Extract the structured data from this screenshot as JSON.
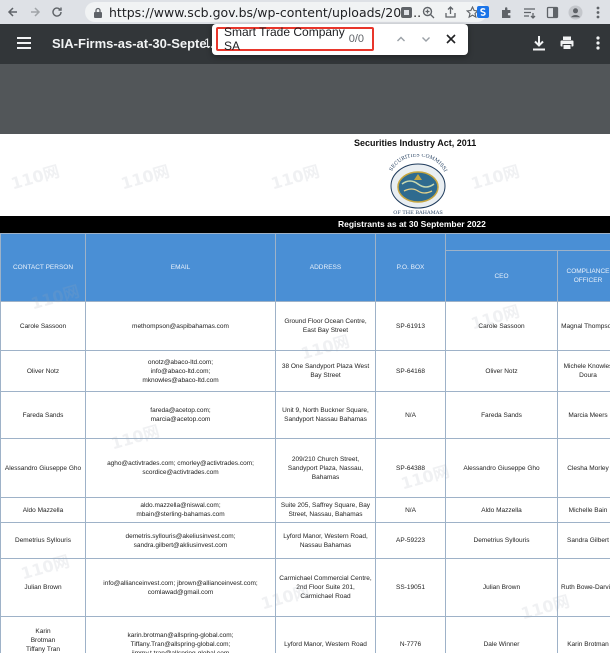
{
  "browser": {
    "url": "https://www.scb.gov.bs/wp-content/uploads/202..."
  },
  "pdf_toolbar": {
    "title": "SIA-Firms-as-at-30-Septe...",
    "page_indicator": "1"
  },
  "find": {
    "query": "Smart Trade Company SA",
    "count": "0/0"
  },
  "document": {
    "act_title": "Securities Industry Act, 2011",
    "seal_top_text": "SECURITIES COMMISSION",
    "seal_bottom_text": "OF THE BAHAMAS",
    "registrants_title": "Registrants as at 30 September 2022",
    "watermark_text": "110网",
    "columns": {
      "contact": "CONTACT PERSON",
      "email": "EMAIL",
      "address": "ADDRESS",
      "pobox": "P.O. BOX",
      "ceo": "CEO",
      "compliance": "COMPLIANCE OFFICER"
    },
    "rows": [
      {
        "contact": "Carole Sassoon",
        "email": "methompson@aspibahamas.com",
        "address": "Ground Floor Ocean Centre, East Bay Street",
        "pobox": "SP-61913",
        "ceo": "Carole Sassoon",
        "compliance": "Magnal Thompson"
      },
      {
        "contact": "Oliver Notz",
        "email": "onotz@abaco-ltd.com; info@abaco-ltd.com; mknowles@abaco-ltd.com",
        "address": "38 One Sandyport Plaza West Bay Street",
        "pobox": "SP-64168",
        "ceo": "Oliver Notz",
        "compliance": "Michele Knowles Doura"
      },
      {
        "contact": "Fareda Sands",
        "email": "fareda@acetop.com; marcia@acetop.com",
        "address": "Unit 9, North Buckner Square, Sandyport Nassau Bahamas",
        "pobox": "N/A",
        "ceo": "Fareda Sands",
        "compliance": "Marcia Meers"
      },
      {
        "contact": "Alessandro Giuseppe Gho",
        "email": "agho@activtrades.com; cmorley@activtrades.com; scordice@activtrades.com",
        "address": "209/210 Church Street, Sandyport Plaza, Nassau, Bahamas",
        "pobox": "SP-64388",
        "ceo": "Alessandro Giuseppe Gho",
        "compliance": "Clesha Morley"
      },
      {
        "contact": "Aldo Mazzella",
        "email": "aldo.mazzella@niswal.com; mbain@sterling-bahamas.com",
        "address": "Suite 205, Saffrey Square, Bay Street, Nassau, Bahamas",
        "pobox": "N/A",
        "ceo": "Aldo Mazzella",
        "compliance": "Michelle Bain"
      },
      {
        "contact": "Demetrius Syllouris",
        "email": "demetris.syllouris@akeliusinvest.com; sandra.gilbert@akliusinvest.com",
        "address": "Lyford Manor, Western Road, Nassau Bahamas",
        "pobox": "AP-59223",
        "ceo": "Demetrius Syllouris",
        "compliance": "Sandra Gilbert"
      },
      {
        "contact": "Julian Brown",
        "email": "info@allianceinvest.com; jbrown@allianceinvest.com; comlawad@gmail.com",
        "address": "Carmichael Commercial Centre, 2nd Floor Suite 201, Carmichael Road",
        "pobox": "SS-19051",
        "ceo": "Julian Brown",
        "compliance": "Ruth Bowe-Darville"
      },
      {
        "contact": "Karin Brotman Tiffany Tran Jimmy Tran",
        "email": "karin.brotman@allspring-global.com; Tiffany.Tran@allspring-global.com; jimmy.t.tran@allspring-global.com",
        "address": "Lyford Manor, Western Road",
        "pobox": "N-7776",
        "ceo": "Dale Winner",
        "compliance": "Karin Brotman"
      }
    ]
  }
}
